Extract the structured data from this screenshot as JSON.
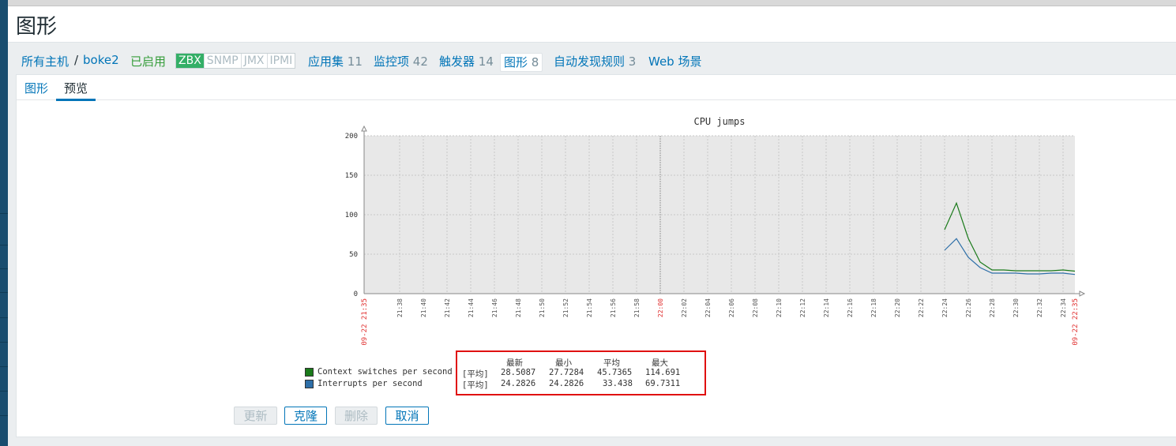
{
  "page": {
    "title": "图形"
  },
  "host_nav": {
    "all_hosts": "所有主机",
    "separator": "/",
    "host": "boke2",
    "status": "已启用",
    "availability": [
      "ZBX",
      "SNMP",
      "JMX",
      "IPMI"
    ],
    "applications": {
      "label": "应用集",
      "count": "11"
    },
    "items": {
      "label": "监控项",
      "count": "42"
    },
    "triggers": {
      "label": "触发器",
      "count": "14"
    },
    "graphs": {
      "label": "图形",
      "count": "8"
    },
    "discovery": {
      "label": "自动发现规则",
      "count": "3"
    },
    "web": {
      "label": "Web 场景"
    }
  },
  "tabs": [
    "图形",
    "预览"
  ],
  "active_tab": "预览",
  "chart_data": {
    "type": "line",
    "title": "CPU jumps",
    "ylim": [
      0,
      200
    ],
    "y_ticks": [
      "0",
      "50",
      "100",
      "150",
      "200"
    ],
    "x_tick_labels": [
      "21:38",
      "21:40",
      "21:42",
      "21:44",
      "21:46",
      "21:48",
      "21:50",
      "21:52",
      "21:54",
      "21:56",
      "21:58",
      "22:00",
      "22:02",
      "22:04",
      "22:06",
      "22:08",
      "22:10",
      "22:12",
      "22:14",
      "22:16",
      "22:18",
      "22:20",
      "22:22",
      "22:24",
      "22:26",
      "22:28",
      "22:30",
      "22:32",
      "22:34"
    ],
    "x_start_label": "09-22 21:35",
    "x_end_label": "09-22 22:35",
    "x_range_minutes": [
      0,
      60
    ],
    "grid": true,
    "colors": {
      "plot_bg": "#e8e8e8",
      "grid": "#c8c8c8",
      "axis": "#888888",
      "time_label": "#555555",
      "time_label_highlight": "#e03030"
    },
    "series": [
      {
        "name": "Context switches per second",
        "color": "#1a7a1a",
        "x": [
          49,
          50,
          51,
          52,
          53,
          54,
          55,
          56,
          57,
          58,
          59,
          60
        ],
        "values": [
          81,
          114.691,
          70,
          40,
          30,
          30,
          29,
          29,
          29,
          29,
          30,
          28.5087
        ]
      },
      {
        "name": "Interrupts per second",
        "color": "#2e6fa8",
        "x": [
          49,
          50,
          51,
          52,
          53,
          54,
          55,
          56,
          57,
          58,
          59,
          60
        ],
        "values": [
          55,
          69.7311,
          46,
          33,
          26,
          26,
          26,
          25,
          25,
          26,
          26,
          24.2826
        ]
      }
    ]
  },
  "legend": {
    "headers": [
      "最新",
      "最小",
      "平均",
      "最大"
    ],
    "rows": [
      {
        "label": "Context switches per second",
        "func": "[平均]",
        "last": "28.5087",
        "min": "27.7284",
        "avg": "45.7365",
        "max": "114.691",
        "color": "#1a7a1a"
      },
      {
        "label": "Interrupts per second",
        "func": "[平均]",
        "last": "24.2826",
        "min": "24.2826",
        "avg": "33.438",
        "max": "69.7311",
        "color": "#2e6fa8"
      }
    ]
  },
  "buttons": {
    "update": "更新",
    "clone": "克隆",
    "delete": "删除",
    "cancel": "取消"
  }
}
